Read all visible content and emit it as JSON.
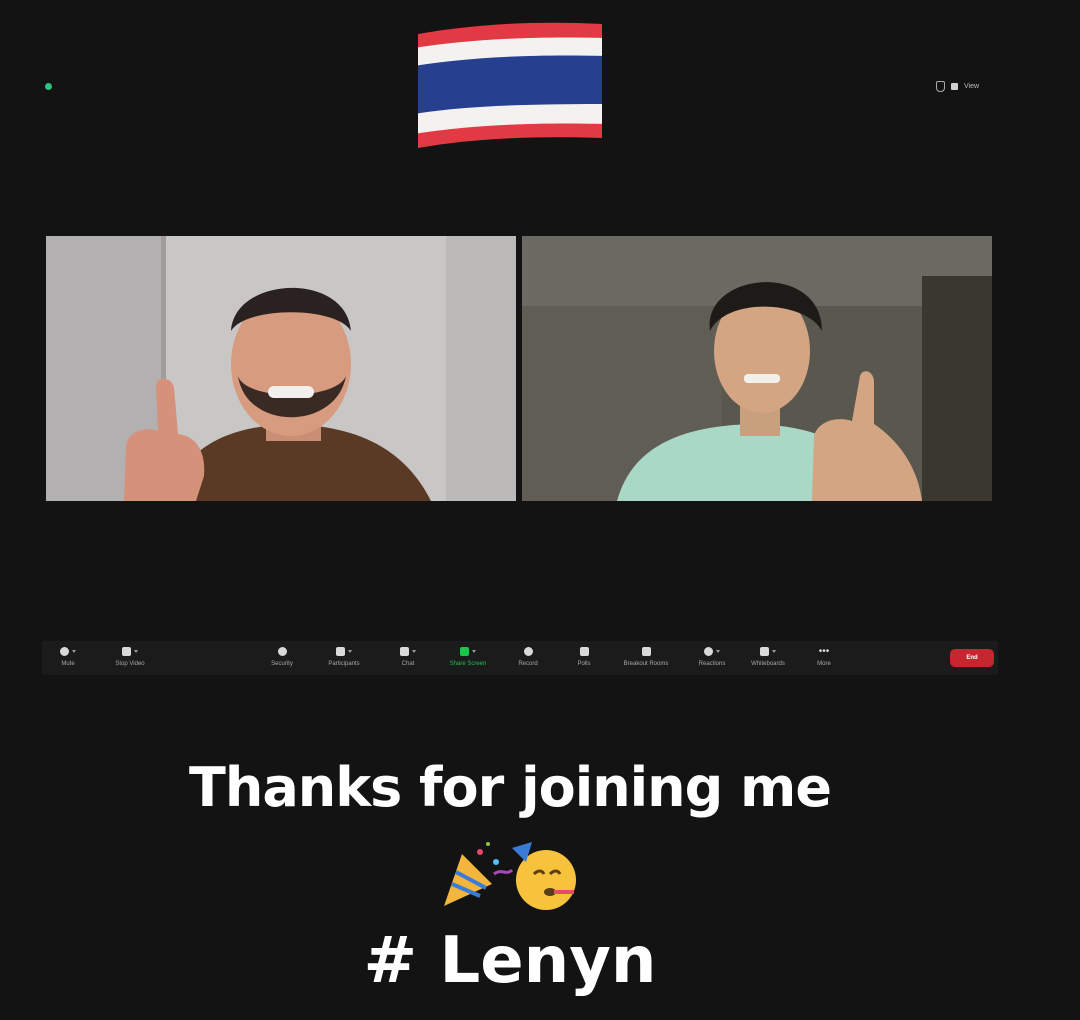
{
  "top_right": {
    "view_label": "View"
  },
  "toolbar": {
    "buttons": [
      {
        "label": "Mute",
        "icon": "mic-icon"
      },
      {
        "label": "Stop Video",
        "icon": "video-icon"
      },
      {
        "label": "Security",
        "icon": "shield-icon"
      },
      {
        "label": "Participants",
        "icon": "participants-icon"
      },
      {
        "label": "Chat",
        "icon": "chat-icon"
      },
      {
        "label": "Share Screen",
        "icon": "share-screen-icon"
      },
      {
        "label": "Record",
        "icon": "record-icon"
      },
      {
        "label": "Polls",
        "icon": "polls-icon"
      },
      {
        "label": "Breakout Rooms",
        "icon": "breakout-rooms-icon"
      },
      {
        "label": "Reactions",
        "icon": "reactions-icon"
      },
      {
        "label": "Whiteboards",
        "icon": "whiteboards-icon"
      },
      {
        "label": "More",
        "icon": "more-icon"
      }
    ],
    "end_label": "End"
  },
  "caption": "Thanks for joining me",
  "hashtag": "# Lenyn",
  "colors": {
    "share_green": "#23c04a",
    "end_red": "#c5262f",
    "background": "#141313"
  }
}
